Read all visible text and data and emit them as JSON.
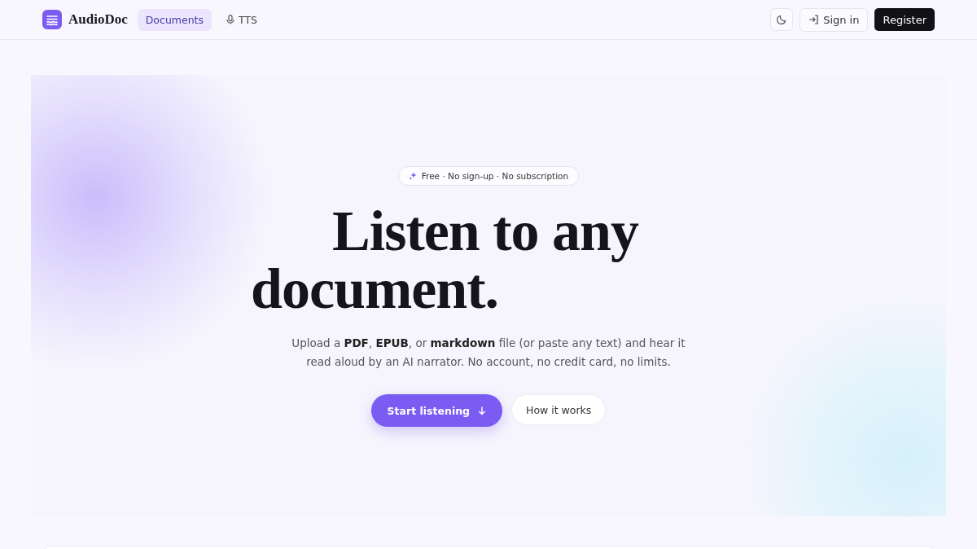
{
  "header": {
    "brand": "AudioDoc",
    "nav": [
      {
        "label": "Documents",
        "selected": true,
        "kind": "text"
      },
      {
        "label": "TTS",
        "selected": false,
        "kind": "mic"
      }
    ],
    "sign_in": "Sign in",
    "register": "Register"
  },
  "hero": {
    "badge": "Free · No sign-up · No subscription",
    "headline_lines": [
      "Listen to any",
      "document."
    ],
    "subtitle": "Upload a **PDF**, **EPUB**, or **markdown** file (or paste any text) and hear it read aloud by an AI narrator. No account, no credit card, no limits.",
    "primary_button": "Start listening",
    "secondary_button": "How it works"
  }
}
